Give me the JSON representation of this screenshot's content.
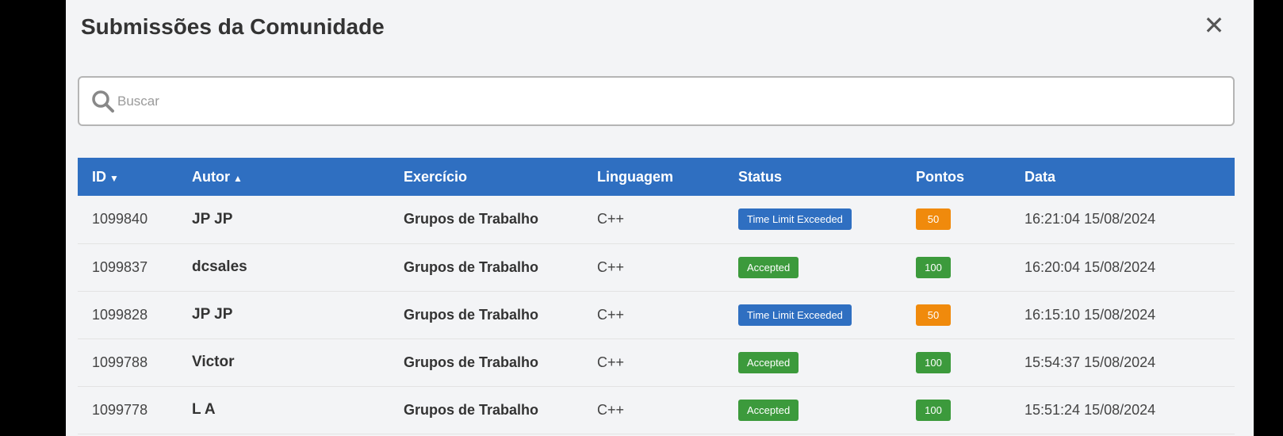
{
  "modal": {
    "title": "Submissões da Comunidade",
    "close_symbol": "✕"
  },
  "search": {
    "placeholder": "Buscar",
    "value": ""
  },
  "table": {
    "headers": {
      "id": "ID",
      "author": "Autor",
      "exercise": "Exercício",
      "language": "Linguagem",
      "status": "Status",
      "points": "Pontos",
      "date": "Data"
    },
    "sort_indicators": {
      "id": "▼",
      "author": "▲"
    },
    "rows": [
      {
        "id": "1099840",
        "author": "JP JP",
        "exercise": "Grupos de Trabalho",
        "language": "C++",
        "status": "Time Limit Exceeded",
        "status_color": "#2f6fc1",
        "points": "50",
        "points_color": "#f08a0c",
        "date": "16:21:04 15/08/2024"
      },
      {
        "id": "1099837",
        "author": "dcsales",
        "exercise": "Grupos de Trabalho",
        "language": "C++",
        "status": "Accepted",
        "status_color": "#3c9a3c",
        "points": "100",
        "points_color": "#3c9a3c",
        "date": "16:20:04 15/08/2024"
      },
      {
        "id": "1099828",
        "author": "JP JP",
        "exercise": "Grupos de Trabalho",
        "language": "C++",
        "status": "Time Limit Exceeded",
        "status_color": "#2f6fc1",
        "points": "50",
        "points_color": "#f08a0c",
        "date": "16:15:10 15/08/2024"
      },
      {
        "id": "1099788",
        "author": "Victor",
        "exercise": "Grupos de Trabalho",
        "language": "C++",
        "status": "Accepted",
        "status_color": "#3c9a3c",
        "points": "100",
        "points_color": "#3c9a3c",
        "date": "15:54:37 15/08/2024"
      },
      {
        "id": "1099778",
        "author": "L A",
        "exercise": "Grupos de Trabalho",
        "language": "C++",
        "status": "Accepted",
        "status_color": "#3c9a3c",
        "points": "100",
        "points_color": "#3c9a3c",
        "date": "15:51:24 15/08/2024"
      }
    ]
  },
  "colors": {
    "header_bg": "#2f6fc1",
    "accepted": "#3c9a3c",
    "tle": "#2f6fc1",
    "partial_points": "#f08a0c"
  }
}
